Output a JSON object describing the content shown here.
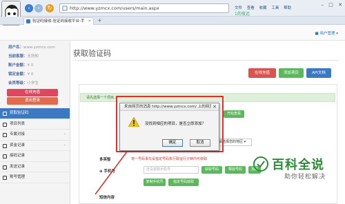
{
  "browser": {
    "url": "http://www.yzmcx.com/users/main.aspx",
    "tools": [
      "文件",
      "查看",
      "收藏",
      "工具",
      "帮助"
    ],
    "search_engine": "1的夜迈",
    "tab_title": "验证码接收-验证码接收平台-手"
  },
  "header": {
    "user_menu": "用户管理"
  },
  "sidebar": {
    "info": [
      {
        "label": "用户名：",
        "value": "www.yzmcx.com"
      },
      {
        "label": "当前客服：",
        "value": "无所知"
      },
      {
        "label": "账户金额：",
        "value": "¥ 0"
      },
      {
        "label": "锁定金额：",
        "value": "¥ 0"
      },
      {
        "label": "会员等级：",
        "value": "小学生"
      }
    ],
    "online_button": "在线充值",
    "logout_button": "退出登录",
    "menu": [
      {
        "label": "获取验证码",
        "active": true
      },
      {
        "label": "项目列表"
      },
      {
        "label": "专属对接"
      },
      {
        "label": "资金记录"
      },
      {
        "label": "接码记录"
      },
      {
        "label": "发送记录"
      },
      {
        "label": "账号管理"
      }
    ]
  },
  "main": {
    "title": "获取验证码",
    "top_buttons": [
      {
        "label": "在线充值",
        "color": "#d9534f"
      },
      {
        "label": "添加项目",
        "color": "#5cb85c"
      },
      {
        "label": "API文档",
        "color": "#3b79c2"
      }
    ],
    "alert": "请先选择一个项目...",
    "start_button": "开始查看",
    "area_select": "请选择您的地区",
    "multi_label": "多英智",
    "notice": "将一号码事先设指定号码执行取运行分钟内可获取",
    "phone_label": "手机号",
    "phone_placeholder": "还没获取手机号",
    "get_phone_button": "获取号码",
    "release_button": "释放号码",
    "blacklist_button": "加黑",
    "copy_button": "复制手机号",
    "fixed_button": "指定号码获取",
    "sms_label": "短信内容"
  },
  "dialog": {
    "title": "来自网页的消息 http://www.yzmcx.com/ 上的网页显示：",
    "message": "没找到相应的项目，是否立即添加？",
    "ok": "确定",
    "cancel": "取消"
  },
  "watermark": {
    "main": "百科全说",
    "sub": "助你轻松解决"
  },
  "colors": {
    "accent": "#3b79c2",
    "highlight": "#e0302a",
    "watermark": "#2d8a3a"
  }
}
